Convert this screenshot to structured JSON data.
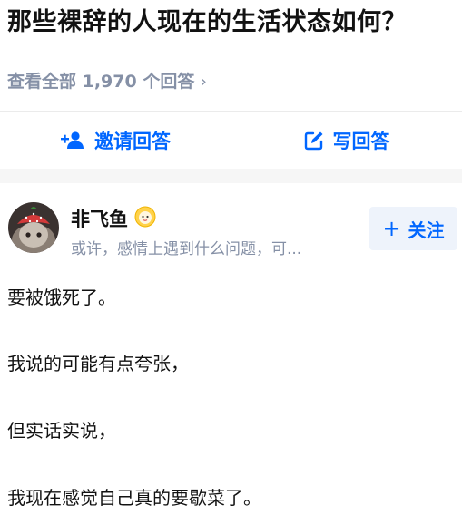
{
  "question": {
    "title": "那些裸辞的人现在的生活状态如何？",
    "view_all": "查看全部 1,970 个回答",
    "chevron": "›"
  },
  "actions": {
    "invite_label": "邀请回答",
    "write_label": "写回答",
    "accent_color": "#0066ff"
  },
  "author": {
    "name": "非飞鱼",
    "bio": "或许，感情上遇到什么问题，可...",
    "follow_plus": "+",
    "follow_label": "关注"
  },
  "answer": {
    "paragraphs": [
      "要被饿死了。",
      "我说的可能有点夸张，",
      "但实话实说，",
      "我现在感觉自己真的要歇菜了。"
    ]
  }
}
